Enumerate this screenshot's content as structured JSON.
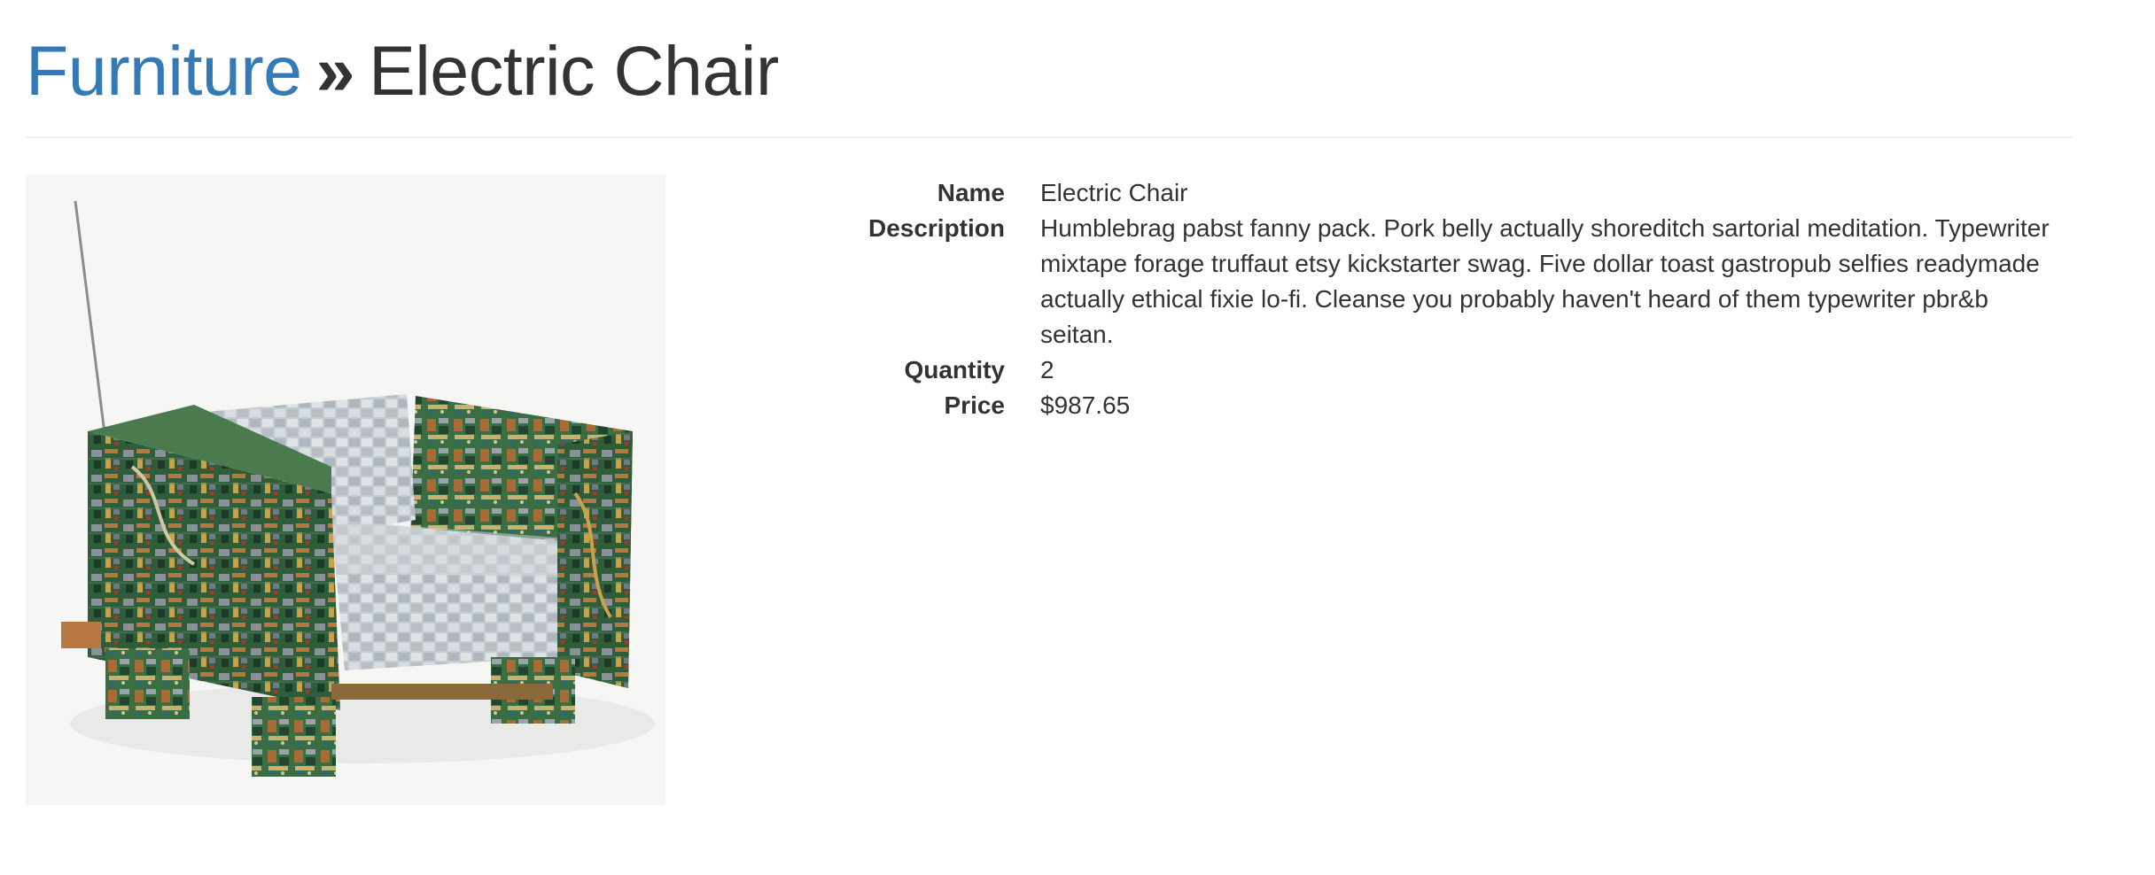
{
  "breadcrumb": {
    "category": "Furniture",
    "separator": "»",
    "current": "Electric Chair"
  },
  "product_image": {
    "subject": "armchair built from circuit boards with grey cushions",
    "colors": {
      "background": "#f6f6f5",
      "board_green": "#2f5d3a",
      "cushion": "#c5cbd0",
      "copper": "#b8783f"
    }
  },
  "details": {
    "name_label": "Name",
    "name_value": "Electric Chair",
    "description_label": "Description",
    "description_value": "Humblebrag pabst fanny pack. Pork belly actually shoreditch sartorial meditation. Typewriter mixtape forage truffaut etsy kickstarter swag. Five dollar toast gastropub selfies readymade actually ethical fixie lo-fi. Cleanse you probably haven't heard of them typewriter pbr&b seitan.",
    "quantity_label": "Quantity",
    "quantity_value": "2",
    "price_label": "Price",
    "price_value": "$987.65"
  },
  "colors": {
    "link": "#337ab7",
    "text": "#333333",
    "divider": "#eeeeee"
  }
}
